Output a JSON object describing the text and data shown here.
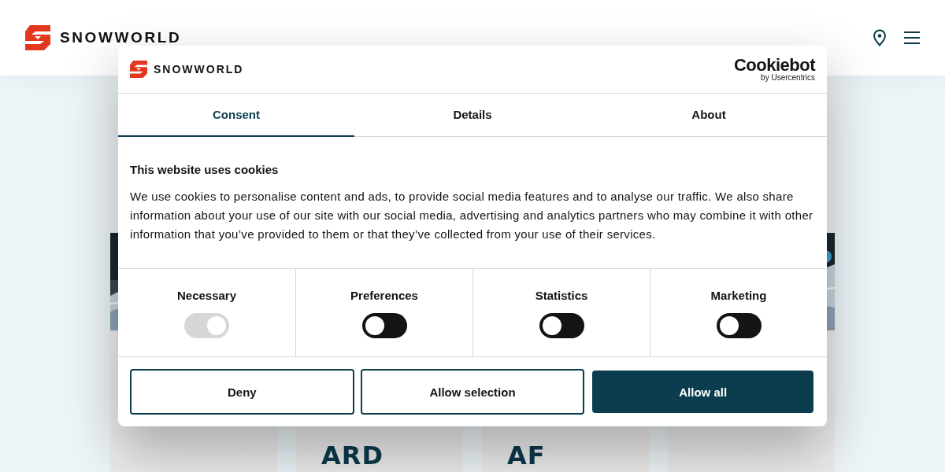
{
  "header": {
    "logo_text": "SNOWWORLD"
  },
  "cards": [
    {
      "kind": "picture"
    },
    {
      "kind": "title",
      "title": "ARD"
    },
    {
      "kind": "title",
      "title": "AF"
    },
    {
      "kind": "picture"
    }
  ],
  "dialog": {
    "logo_text": "SNOWWORLD",
    "provider": "Cookiebot",
    "provider_sub": "by Usercentrics",
    "tabs": [
      {
        "label": "Consent",
        "selected": true
      },
      {
        "label": "Details",
        "selected": false
      },
      {
        "label": "About",
        "selected": false
      }
    ],
    "title": "This website uses cookies",
    "text": "We use cookies to personalise content and ads, to provide social media features and to analyse our traffic. We also share information about your use of our site with our social media, advertising and analytics partners who may combine it with other information that you’ve provided to them or that they’ve collected from your use of their services.",
    "toggles": [
      {
        "label": "Necessary",
        "checked": true,
        "disabled": true
      },
      {
        "label": "Preferences",
        "checked": false,
        "disabled": false
      },
      {
        "label": "Statistics",
        "checked": false,
        "disabled": false
      },
      {
        "label": "Marketing",
        "checked": false,
        "disabled": false
      }
    ],
    "buttons": [
      {
        "label": "Deny",
        "kind": "outline"
      },
      {
        "label": "Allow selection",
        "kind": "outline"
      },
      {
        "label": "Allow all",
        "kind": "primary"
      }
    ]
  }
}
